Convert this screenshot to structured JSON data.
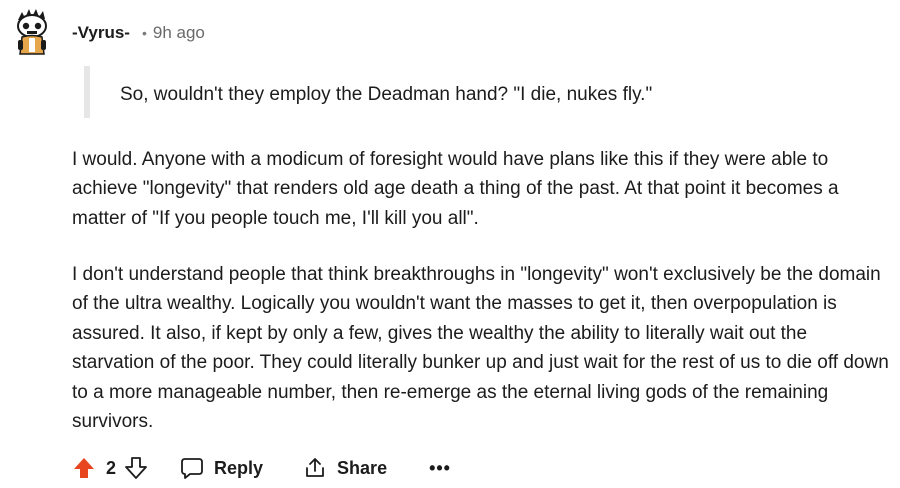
{
  "comment": {
    "author": "-Vyrus-",
    "separator": "•",
    "time": "9h ago",
    "avatar_icon": "snoo-avatar-icon",
    "quote": "So, wouldn't they employ the Deadman hand? \"I die, nukes fly.\"",
    "paragraphs": [
      "I would. Anyone with a modicum of foresight would have plans like this if they were able to achieve \"longevity\" that renders old age death a thing of the past. At that point it becomes a matter of \"If you people touch me, I'll kill you all\".",
      "I don't understand people that think breakthroughs in \"longevity\" won't exclusively be the domain of the ultra wealthy. Logically you wouldn't want the masses to get it, then overpopulation is assured. It also, if kept by only a few, gives the wealthy the ability to literally wait out the starvation of the poor. They could literally bunker up and just wait for the rest of us to die off down to a more manageable number, then re-emerge as the eternal living gods of the remaining survivors."
    ]
  },
  "actions": {
    "upvote_icon": "upvote-arrow-icon",
    "vote_count": "2",
    "downvote_icon": "downvote-arrow-icon",
    "reply_label": "Reply",
    "share_label": "Share",
    "more_label": "•••"
  },
  "colors": {
    "upvote_active": "#e8461e",
    "quote_border": "#e6e6e6",
    "text": "#1c1c1c",
    "muted": "#6a6a6a"
  }
}
